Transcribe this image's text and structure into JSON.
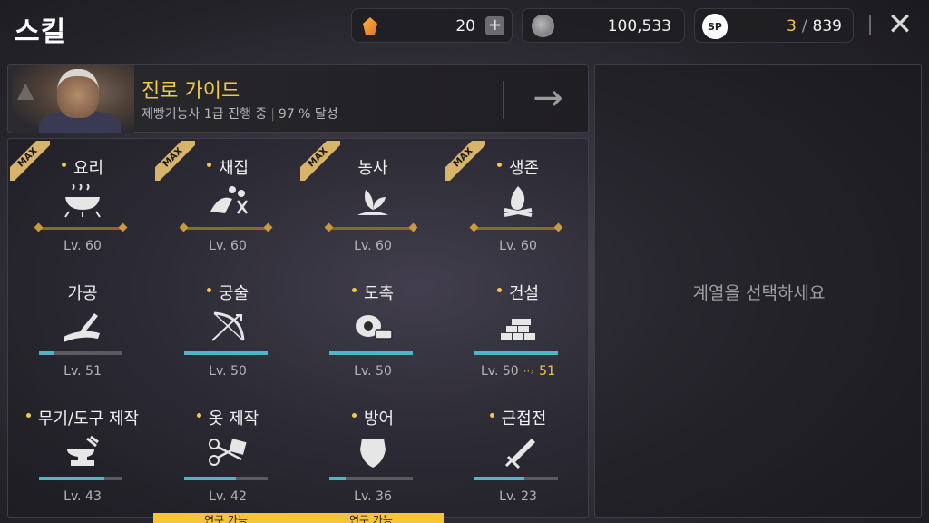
{
  "header": {
    "title": "스킬",
    "gem_value": "20",
    "plus_label": "+",
    "coin_value": "100,533",
    "sp_icon_label": "SP",
    "sp_current": "3",
    "sp_separator": "/",
    "sp_total": "839",
    "close_label": "✕"
  },
  "guide": {
    "title": "진로 가이드",
    "progress_text": "제빵기능사 1급 진행 중",
    "separator": "|",
    "percent_text": "97 % 달성",
    "arrow_label": "→"
  },
  "skills": [
    {
      "name": "요리",
      "level": "Lv. 60",
      "badge": "MAX",
      "icon": "cooking-pot-icon",
      "progress": 1.0
    },
    {
      "name": "채집",
      "level": "Lv. 60",
      "badge": "MAX",
      "icon": "gathering-icon",
      "progress": 1.0
    },
    {
      "name": "농사",
      "level": "Lv. 60",
      "badge": "MAX",
      "icon": "farming-sprout-icon",
      "progress": 1.0
    },
    {
      "name": "생존",
      "level": "Lv. 60",
      "badge": "MAX",
      "icon": "campfire-icon",
      "progress": 1.0
    },
    {
      "name": "가공",
      "level": "Lv. 51",
      "icon": "processing-icon",
      "progress": 0.18
    },
    {
      "name": "궁술",
      "level": "Lv. 50",
      "icon": "bow-icon",
      "progress": 1.0,
      "research": "연구 가능"
    },
    {
      "name": "도축",
      "level": "Lv. 50",
      "icon": "meat-icon",
      "progress": 1.0,
      "research": "연구 가능"
    },
    {
      "name": "건설",
      "level": "Lv. 50",
      "next_level": "51",
      "level_arrow": "··›",
      "icon": "bricks-icon",
      "progress": 1.0
    },
    {
      "name": "무기/도구 제작",
      "level": "Lv. 43",
      "icon": "anvil-icon",
      "progress": 0.78
    },
    {
      "name": "옷 제작",
      "level": "Lv. 42",
      "icon": "scissors-icon",
      "progress": 0.62
    },
    {
      "name": "방어",
      "level": "Lv. 36",
      "icon": "shield-icon",
      "progress": 0.2
    },
    {
      "name": "근접전",
      "level": "Lv. 23",
      "icon": "dagger-icon",
      "progress": 0.6
    }
  ],
  "detail_hint": "계열을 선택하세요",
  "colors": {
    "accent_gold": "#f1c84b",
    "progress_teal": "#4fb6c6",
    "research_yellow": "#f4c43a"
  }
}
